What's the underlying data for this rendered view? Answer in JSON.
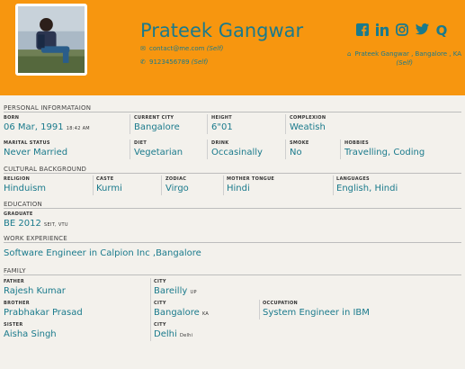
{
  "profile": {
    "name": "Prateek Gangwar",
    "email": "contact@me.com",
    "email_note": "(Self)",
    "phone": "9123456789",
    "phone_note": "(Self)",
    "location": "Prateek Gangwar , Bangalore , KA",
    "location_note": "(Self)"
  },
  "socials": [
    {
      "name": "facebook",
      "glyph": "f"
    },
    {
      "name": "linkedin",
      "glyph": "in"
    },
    {
      "name": "instagram",
      "glyph": "◎"
    },
    {
      "name": "twitter",
      "glyph": "🐦"
    },
    {
      "name": "quora",
      "glyph": "Q"
    }
  ],
  "personal": {
    "title": "PERSONAL INFORMATAION",
    "born_label": "BORN",
    "born_value": "06 Mar, 1991",
    "born_time": "18:42 AM",
    "city_label": "CURRENT CITY",
    "city_value": "Bangalore",
    "height_label": "HEIGHT",
    "height_value": "6\"01",
    "complexion_label": "COMPLEXION",
    "complexion_value": "Weatish",
    "marital_label": "MARITAL STATUS",
    "marital_value": "Never Married",
    "diet_label": "DIET",
    "diet_value": "Vegetarian",
    "drink_label": "DRINK",
    "drink_value": "Occasinally",
    "smoke_label": "SMOKE",
    "smoke_value": "No",
    "hobbies_label": "HOBBIES",
    "hobbies_value": "Travelling, Coding"
  },
  "cultural": {
    "title": "CULTURAL BACKGROUND",
    "religion_label": "RELIGION",
    "religion_value": "Hinduism",
    "caste_label": "CASTE",
    "caste_value": "Kurmi",
    "zodiac_label": "ZODIAC",
    "zodiac_value": "Virgo",
    "tongue_label": "MOTHER TONGUE",
    "tongue_value": "Hindi",
    "languages_label": "LANGUAGES",
    "languages_value": "English, Hindi"
  },
  "education": {
    "title": "EDUCATION",
    "grad_label": "GRADUATE",
    "grad_value": "BE 2012",
    "grad_note": "SEIT, VTU"
  },
  "work": {
    "title": "WORK EXPERIENCE",
    "value": "Software Engineer in Calpion Inc ,Bangalore"
  },
  "family": {
    "title": "FAMILY",
    "father_label": "FATHER",
    "father_value": "Rajesh Kumar",
    "father_city_label": "CITY",
    "father_city_value": "Bareilly",
    "father_city_state": "UP",
    "brother_label": "BROTHER",
    "brother_value": "Prabhakar Prasad",
    "brother_city_label": "CITY",
    "brother_city_value": "Bangalore",
    "brother_city_state": "KA",
    "occupation_label": "OCCUPATION",
    "occupation_value": "System Engineer in IBM",
    "sister_label": "SISTER",
    "sister_value": "Aisha Singh",
    "sister_city_label": "CITY",
    "sister_city_value": "Delhi",
    "sister_city_state": "Delhi"
  }
}
